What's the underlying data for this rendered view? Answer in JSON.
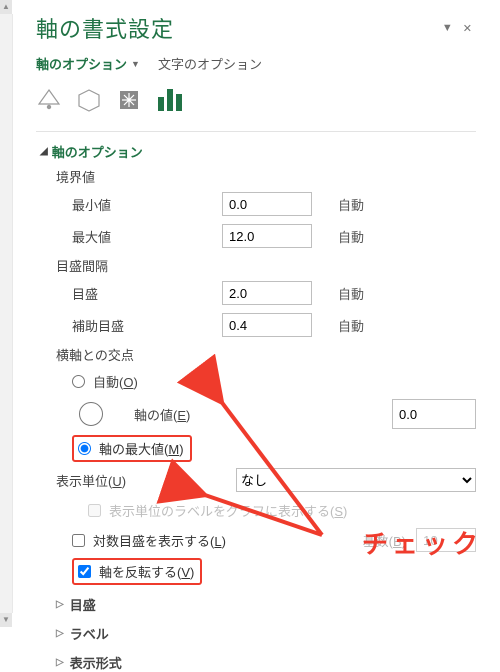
{
  "header": {
    "title": "軸の書式設定"
  },
  "tabs": {
    "axis_opts": "軸のオプション",
    "text_opts": "文字のオプション"
  },
  "icons": {
    "fill": "fill-line-icon",
    "effects": "effects-icon",
    "sizeprops": "size-properties-icon",
    "axis": "axis-options-icon"
  },
  "group": {
    "title": "軸のオプション",
    "bounds_label": "境界値",
    "min_label": "最小値",
    "min_value": "0.0",
    "min_auto": "自動",
    "max_label": "最大値",
    "max_value": "12.0",
    "max_auto": "自動",
    "ticks_label": "目盛間隔",
    "major_label": "目盛",
    "major_value": "2.0",
    "major_auto": "自動",
    "minor_label": "補助目盛",
    "minor_value": "0.4",
    "minor_auto": "自動",
    "cross_label": "横軸との交点",
    "cross_auto": "自動(",
    "cross_auto_u": "O",
    "cross_auto_c": ")",
    "cross_val": "軸の値(",
    "cross_val_u": "E",
    "cross_val_c": ")",
    "cross_val_num": "0.0",
    "cross_max": "軸の最大値(",
    "cross_max_u": "M",
    "cross_max_c": ")",
    "disp_unit": "表示単位(",
    "disp_unit_u": "U",
    "disp_unit_c": ")",
    "disp_unit_sel": "なし",
    "disp_unit_chk": "表示単位のラベルをグラフに表示する(",
    "disp_unit_chk_u": "S",
    "disp_unit_chk_c": ")",
    "log_chk": "対数目盛を表示する(",
    "log_chk_u": "L",
    "log_chk_c": ")",
    "base_lbl": "基数(",
    "base_u": "B",
    "base_c": ")",
    "base_val": "10",
    "reverse_chk": "軸を反転する(",
    "reverse_u": "V",
    "reverse_c": ")"
  },
  "sections": {
    "ticks": "目盛",
    "labels": "ラベル",
    "numfmt": "表示形式"
  },
  "annotation": "チェック"
}
